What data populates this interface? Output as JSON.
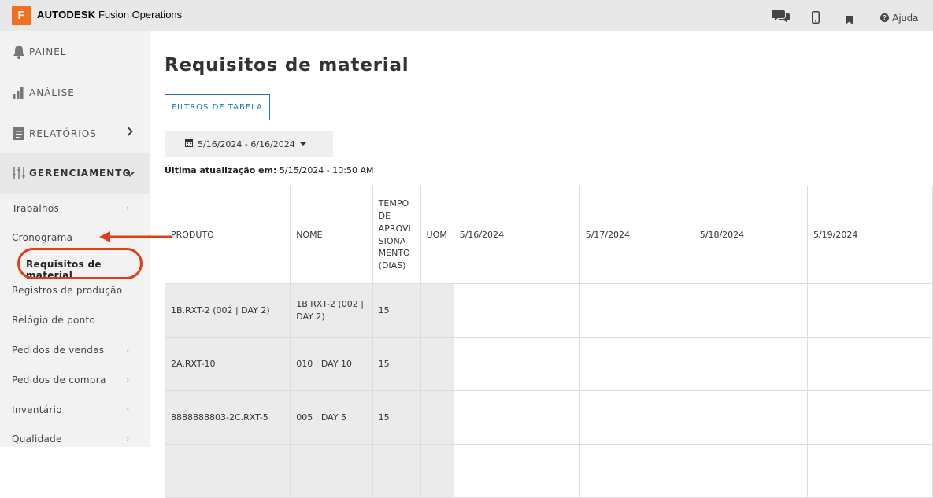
{
  "header": {
    "brand_bold": "AUTODESK",
    "brand_rest": "Fusion Operations",
    "logo_letter": "F",
    "help_label": "Ajuda",
    "icons": [
      "chat-icon",
      "mobile-icon",
      "bookmark-icon",
      "help-icon"
    ]
  },
  "sidebar": {
    "sections": [
      {
        "label": "PAINEL",
        "icon": "bell-icon"
      },
      {
        "label": "ANÁLISE",
        "icon": "bar-chart-icon"
      },
      {
        "label": "RELATÓRIOS",
        "icon": "document-icon"
      },
      {
        "label": "GERENCIAMENTO",
        "icon": "sliders-icon"
      }
    ],
    "items": [
      {
        "label": "Trabalhos"
      },
      {
        "label": "Cronograma"
      },
      {
        "label": "Requisitos de material"
      },
      {
        "label": "Registros de produção"
      },
      {
        "label": "Relógio de ponto"
      },
      {
        "label": "Pedidos de vendas"
      },
      {
        "label": "Pedidos de compra"
      },
      {
        "label": "Inventário"
      },
      {
        "label": "Qualidade"
      }
    ]
  },
  "main": {
    "title": "Requisitos de material",
    "filter_button": "FILTROS DE TABELA",
    "date_range": "5/16/2024 - 6/16/2024",
    "updated_label": "Última atualização em:",
    "updated_value": "5/15/2024 - 10:50 AM"
  },
  "table": {
    "headers": [
      "PRODUTO",
      "NOME",
      "TEMPO DE APROVISIONAMENTO (DIAS)",
      "UOM",
      "5/16/2024",
      "5/17/2024",
      "5/18/2024",
      "5/19/2024"
    ],
    "lead_time_lines": [
      "TEMPO",
      "DE",
      "APROVI",
      "SIONA",
      "MENTO",
      "(DIAS)"
    ],
    "rows": [
      {
        "produto": "1B.RXT-2 (002 | DAY 2)",
        "nome_l1": "1B.RXT-2 (002 |",
        "nome_l2": "DAY 2)",
        "tempo": "15",
        "uom": ""
      },
      {
        "produto": "2A.RXT-10",
        "nome_l1": "010 | DAY 10",
        "nome_l2": "",
        "tempo": "15",
        "uom": ""
      },
      {
        "produto": "8888888803-2C.RXT-5",
        "nome_l1": "005 | DAY 5",
        "nome_l2": "",
        "tempo": "15",
        "uom": ""
      }
    ]
  },
  "colors": {
    "accent": "#1976b5",
    "brand_orange": "#f37021",
    "annotation_red": "#e33b1a"
  }
}
